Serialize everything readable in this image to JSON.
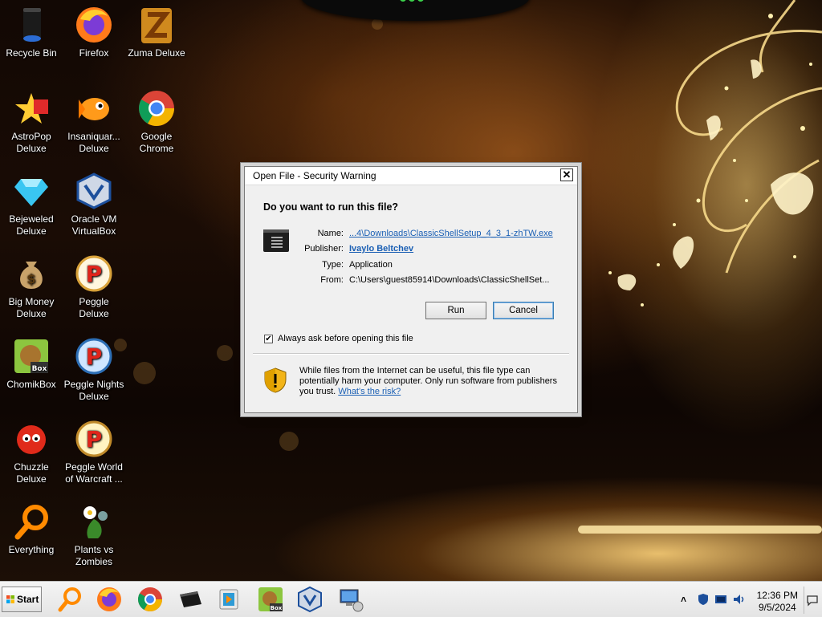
{
  "desktop": {
    "icons": [
      {
        "label": "Recycle Bin",
        "icon": "recycle-bin-icon"
      },
      {
        "label": "Firefox",
        "icon": "firefox-icon"
      },
      {
        "label": "Zuma Deluxe",
        "icon": "zuma-icon"
      },
      {
        "label": "AstroPop Deluxe",
        "icon": "astropop-icon"
      },
      {
        "label": "Insaniquar... Deluxe",
        "icon": "insaniquarium-icon"
      },
      {
        "label": "Google Chrome",
        "icon": "chrome-icon"
      },
      {
        "label": "Bejeweled Deluxe",
        "icon": "bejeweled-icon"
      },
      {
        "label": "Oracle VM VirtualBox",
        "icon": "virtualbox-icon"
      },
      {
        "label": "Big Money Deluxe",
        "icon": "big-money-icon"
      },
      {
        "label": "Peggle Deluxe",
        "icon": "peggle-icon"
      },
      {
        "label": "ChomikBox",
        "icon": "chomikbox-icon"
      },
      {
        "label": "Peggle Nights Deluxe",
        "icon": "peggle-nights-icon"
      },
      {
        "label": "Chuzzle Deluxe",
        "icon": "chuzzle-icon"
      },
      {
        "label": "Peggle World of Warcraft ...",
        "icon": "peggle-wow-icon"
      },
      {
        "label": "Everything",
        "icon": "everything-search-icon"
      },
      {
        "label": "Plants vs Zombies",
        "icon": "plants-vs-zombies-icon"
      }
    ]
  },
  "dialog": {
    "title": "Open File - Security Warning",
    "close_glyph": "✕",
    "question": "Do you want to run this file?",
    "fields": {
      "name_label": "Name:",
      "name_value": "...4\\Downloads\\ClassicShellSetup_4_3_1-zhTW.exe",
      "publisher_label": "Publisher:",
      "publisher_value": "Ivaylo Beltchev",
      "type_label": "Type:",
      "type_value": "Application",
      "from_label": "From:",
      "from_value": "C:\\Users\\guest85914\\Downloads\\ClassicShellSet..."
    },
    "run_label": "Run",
    "cancel_label": "Cancel",
    "always_ask_label": "Always ask before opening this file",
    "always_ask_checked": true,
    "warning_text": "While files from the Internet can be useful, this file type can potentially harm your computer. Only run software from publishers you trust.",
    "risk_link": "What's the risk?"
  },
  "taskbar": {
    "start_label": "Start",
    "pinned": [
      "everything-search-icon",
      "firefox-icon",
      "chrome-icon",
      "terminal-icon",
      "media-player-icon",
      "chomikbox-icon",
      "virtualbox-icon",
      "network-computer-icon"
    ],
    "tray": {
      "time": "12:36 PM",
      "date": "9/5/2024",
      "icons": [
        "show-hidden-icons-chevron",
        "network-shield-icon",
        "display-icon",
        "volume-icon"
      ]
    }
  }
}
